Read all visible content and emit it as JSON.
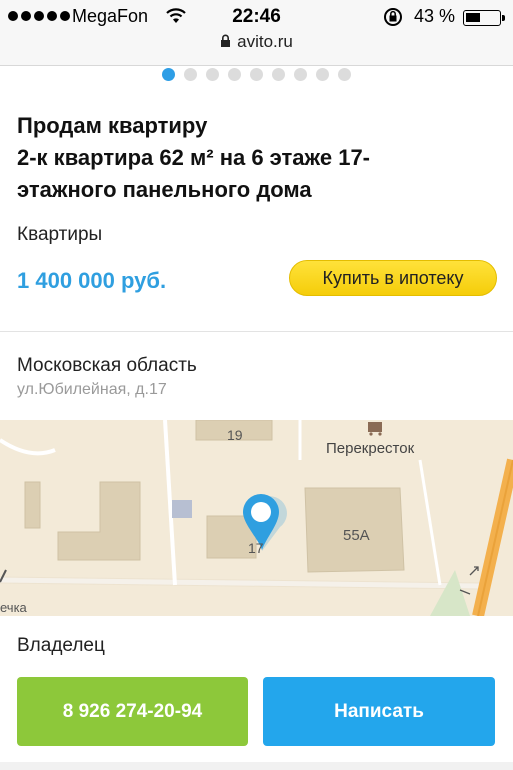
{
  "status_bar": {
    "carrier": "MegaFon",
    "time": "22:46",
    "battery_percent": "43 %",
    "battery_level": 0.43
  },
  "browser": {
    "url": "avito.ru"
  },
  "gallery": {
    "total_photos": 9,
    "active_index": 0
  },
  "listing": {
    "title_line1": "Продам квартиру",
    "title_line2": "2-к квартира 62 м² на 6 этаже 17-",
    "title_line3": "этажного панельного дома",
    "category": "Квартиры",
    "price": "1 400 000 руб.",
    "mortgage_button": "Купить в ипотеку",
    "region": "Московская область",
    "address": "ул.Юбилейная, д.17"
  },
  "map": {
    "labels": {
      "building_19": "19",
      "store": "Перекресток",
      "building_55a": "55А",
      "building_17": "17",
      "street_fragment": "ечка"
    }
  },
  "seller": {
    "type": "Владелец",
    "phone": "8 926 274-20-94",
    "message_button": "Написать"
  },
  "colors": {
    "accent_blue": "#2f9fe0",
    "call_green": "#8dc83a",
    "write_blue": "#23a6ec",
    "mortgage_yellow": "#ffd81c"
  }
}
